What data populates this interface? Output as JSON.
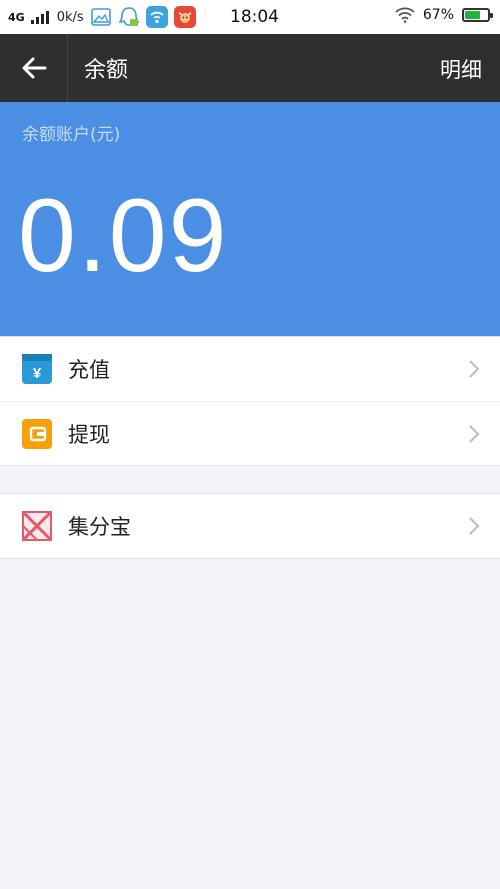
{
  "status_bar": {
    "network": "4G",
    "speed": "0k/s",
    "time": "18:04",
    "battery": "67%",
    "battery_level": 0.67,
    "apps": [
      "gallery-icon",
      "qq-icon",
      "wifi-app-icon",
      "cow-app-icon"
    ]
  },
  "header": {
    "title": "余额",
    "action": "明细"
  },
  "balance": {
    "label": "余额账户(元)",
    "value": "0.09"
  },
  "menu": {
    "recharge": "充值",
    "withdraw": "提现",
    "jifenbao": "集分宝"
  },
  "colors": {
    "header_bg": "#2f2f2f",
    "balance_bg": "#4b8fe4",
    "recharge_icon": "#2a9ad6",
    "withdraw_icon": "#f5a20a",
    "jifenbao_icon": "#e45a6a"
  }
}
